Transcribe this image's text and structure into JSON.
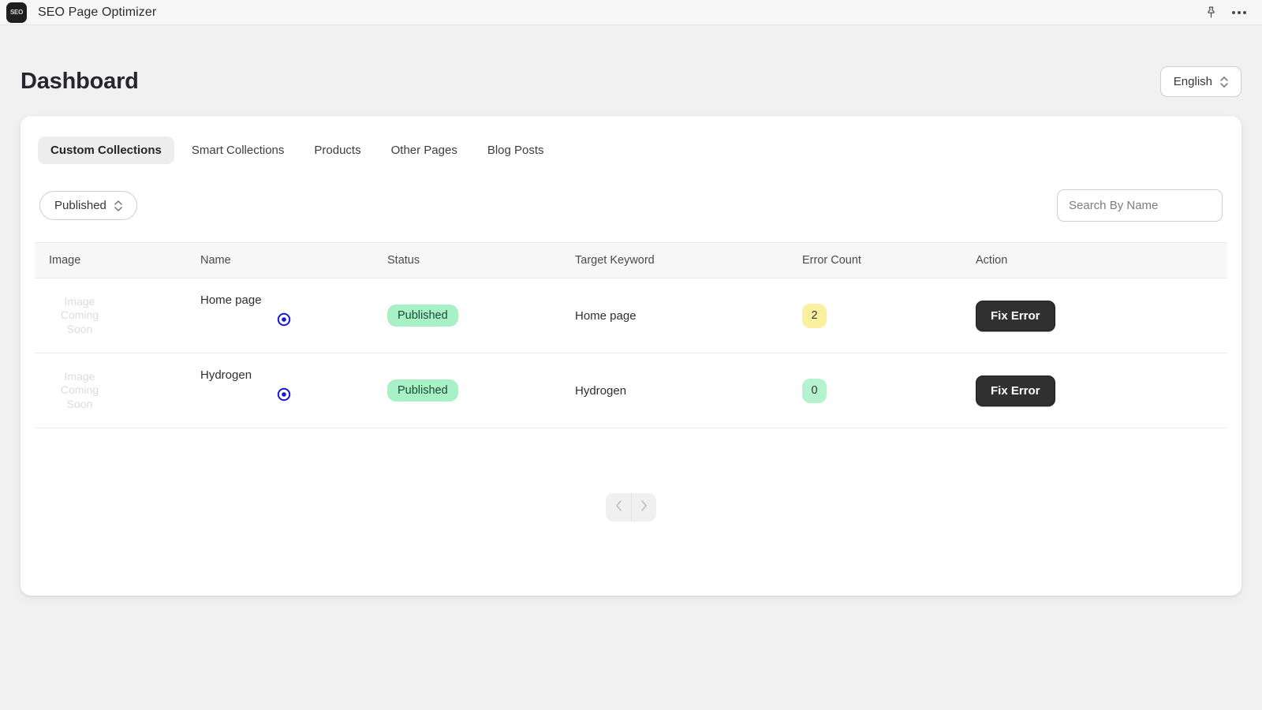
{
  "appbar": {
    "logo_text": "SEO",
    "title": "SEO Page Optimizer",
    "pin_icon": "pin-icon",
    "more_icon": "more-horizontal-icon"
  },
  "header": {
    "title": "Dashboard",
    "language_value": "English"
  },
  "tabs": [
    {
      "label": "Custom Collections",
      "active": true
    },
    {
      "label": "Smart Collections",
      "active": false
    },
    {
      "label": "Products",
      "active": false
    },
    {
      "label": "Other Pages",
      "active": false
    },
    {
      "label": "Blog Posts",
      "active": false
    }
  ],
  "filters": {
    "status_value": "Published",
    "search_placeholder": "Search By Name",
    "search_value": ""
  },
  "table": {
    "columns": [
      "Image",
      "Name",
      "Status",
      "Target Keyword",
      "Error Count",
      "Action"
    ],
    "image_placeholder_text": "Image\nComing\nSoon",
    "image_placeholder_line1": "Image",
    "image_placeholder_line2": "Coming",
    "image_placeholder_line3": "Soon",
    "rows": [
      {
        "name": "Home page",
        "status": "Published",
        "target_keyword": "Home page",
        "error_count": "2",
        "error_level": "warn",
        "action_label": "Fix Error"
      },
      {
        "name": "Hydrogen",
        "status": "Published",
        "target_keyword": "Hydrogen",
        "error_count": "0",
        "error_level": "ok",
        "action_label": "Fix Error"
      }
    ]
  },
  "pagination": {
    "prev_icon": "chevron-left-icon",
    "next_icon": "chevron-right-icon"
  },
  "colors": {
    "page_bg": "#f1f1f1",
    "card_bg": "#ffffff",
    "accent_dark": "#303030",
    "badge_green": "#a8f0c6",
    "count_yellow": "#fbf0a0",
    "count_green": "#b5f3cf",
    "view_icon_blue": "#1a16d8"
  }
}
